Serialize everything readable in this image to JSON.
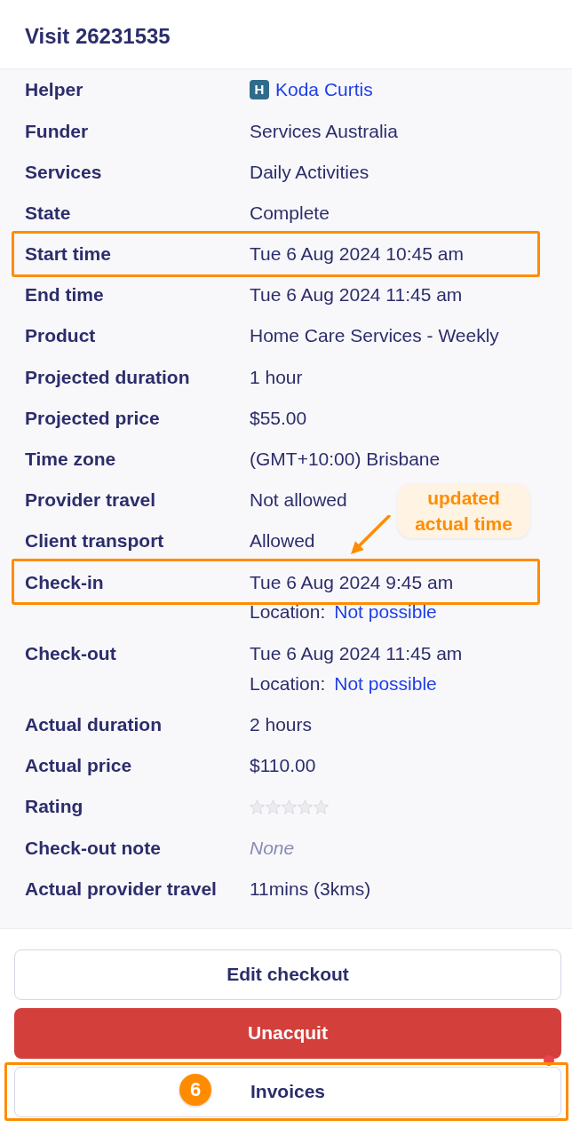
{
  "header": {
    "title": "Visit 26231535"
  },
  "fields": [
    {
      "label": "Helper",
      "kind": "person",
      "badge": "H",
      "value": "Koda Curtis",
      "highlighted": false
    },
    {
      "label": "Funder",
      "kind": "text",
      "value": "Services Australia",
      "highlighted": false
    },
    {
      "label": "Services",
      "kind": "text",
      "value": "Daily Activities",
      "highlighted": false
    },
    {
      "label": "State",
      "kind": "text",
      "value": "Complete",
      "highlighted": false
    },
    {
      "label": "Start time",
      "kind": "text",
      "value": "Tue 6 Aug 2024 10:45 am",
      "highlighted": true
    },
    {
      "label": "End time",
      "kind": "text",
      "value": "Tue 6 Aug 2024 11:45 am",
      "highlighted": false
    },
    {
      "label": "Product",
      "kind": "text",
      "value": "Home Care Services - Weekly",
      "highlighted": false
    },
    {
      "label": "Projected duration",
      "kind": "text",
      "value": "1 hour",
      "highlighted": false
    },
    {
      "label": "Projected price",
      "kind": "text",
      "value": "$55.00",
      "highlighted": false
    },
    {
      "label": "Time zone",
      "kind": "text",
      "value": "(GMT+10:00) Brisbane",
      "highlighted": false
    },
    {
      "label": "Provider travel",
      "kind": "text",
      "value": "Not allowed",
      "highlighted": false
    },
    {
      "label": "Client transport",
      "kind": "text",
      "value": "Allowed",
      "highlighted": false
    },
    {
      "label": "Check-in",
      "kind": "timestamp_location",
      "value": "Tue 6 Aug 2024 9:45 am",
      "location_label": "Location:",
      "location_value": "Not possible",
      "highlighted": true,
      "callout": "updated actual time"
    },
    {
      "label": "Check-out",
      "kind": "timestamp_location",
      "value": "Tue 6 Aug 2024 11:45 am",
      "location_label": "Location:",
      "location_value": "Not possible",
      "highlighted": false
    },
    {
      "label": "Actual duration",
      "kind": "text",
      "value": "2 hours",
      "highlighted": false
    },
    {
      "label": "Actual price",
      "kind": "text",
      "value": "$110.00",
      "highlighted": false
    },
    {
      "label": "Rating",
      "kind": "rating",
      "stars": 0,
      "highlighted": false
    },
    {
      "label": "Check-out note",
      "kind": "note",
      "value": "None",
      "highlighted": false
    },
    {
      "label": "Actual provider travel",
      "kind": "text",
      "value": "11mins (3kms)",
      "highlighted": false
    }
  ],
  "actions": [
    {
      "label": "Edit checkout",
      "kind": "secondary",
      "highlighted": false,
      "notification": false
    },
    {
      "label": "Unacquit",
      "kind": "danger",
      "highlighted": false,
      "notification": false
    },
    {
      "label": "Invoices",
      "kind": "secondary",
      "highlighted": true,
      "notification": true,
      "step": "6"
    }
  ]
}
